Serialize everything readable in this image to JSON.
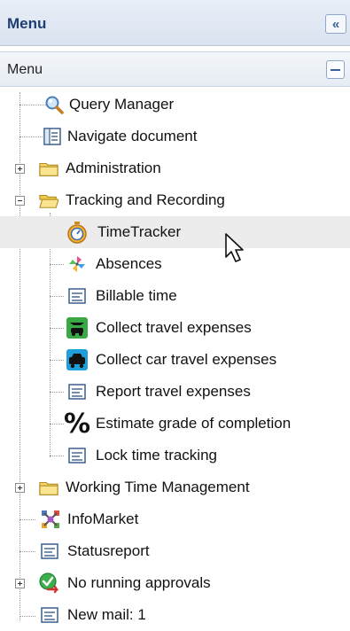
{
  "header": {
    "title": "Menu",
    "collapse_glyph": "«"
  },
  "subheader": {
    "title": "Menu"
  },
  "tree": [
    {
      "label": "Query Manager",
      "icon": "magnifier-icon",
      "level": 1
    },
    {
      "label": "Navigate document",
      "icon": "document-nav-icon",
      "level": 1
    },
    {
      "label": "Administration",
      "icon": "folder-icon",
      "level": 0,
      "expanded": false
    },
    {
      "label": "Tracking and Recording",
      "icon": "folder-open-icon",
      "level": 0,
      "expanded": true
    },
    {
      "label": "TimeTracker",
      "icon": "stopwatch-icon",
      "level": 2,
      "selected": true
    },
    {
      "label": "Absences",
      "icon": "pinwheel-icon",
      "level": 2
    },
    {
      "label": "Billable time",
      "icon": "list-document-icon",
      "level": 2
    },
    {
      "label": "Collect travel expenses",
      "icon": "plane-car-icon",
      "level": 2
    },
    {
      "label": "Collect car travel expenses",
      "icon": "car-icon",
      "level": 2
    },
    {
      "label": "Report travel expenses",
      "icon": "list-document-icon",
      "level": 2
    },
    {
      "label": "Estimate grade of completion",
      "icon": "percent-icon",
      "level": 2
    },
    {
      "label": "Lock time tracking",
      "icon": "list-document-icon",
      "level": 2
    },
    {
      "label": "Working Time Management",
      "icon": "folder-icon",
      "level": 0,
      "expanded": false
    },
    {
      "label": "InfoMarket",
      "icon": "infomarket-icon",
      "level": 1
    },
    {
      "label": "Statusreport",
      "icon": "list-document-icon",
      "level": 1
    },
    {
      "label": "No running approvals",
      "icon": "approval-check-icon",
      "level": 0,
      "expanded": false
    },
    {
      "label": "New mail: 1",
      "icon": "list-document-icon",
      "level": 1
    }
  ]
}
